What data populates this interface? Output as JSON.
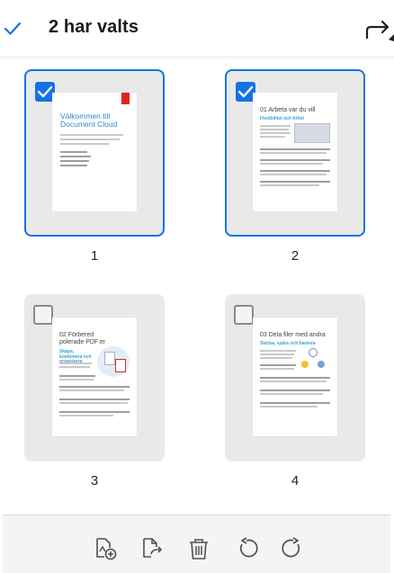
{
  "header": {
    "title": "2 har valts"
  },
  "pages": [
    {
      "number": "1",
      "selected": true,
      "title": "Välkommen till Document Cloud"
    },
    {
      "number": "2",
      "selected": true,
      "title": "01 Arbeta var du vill",
      "subtitle": "Flexibilitet och frihet"
    },
    {
      "number": "3",
      "selected": false,
      "title": "02 Förbered polerade PDF:er",
      "subtitle": "Skapa, kombinera och organisera"
    },
    {
      "number": "4",
      "selected": false,
      "title": "03 Dela filer med andra",
      "subtitle": "Skicka, spåra och hantera"
    }
  ],
  "colors": {
    "accent": "#1473e6",
    "card_bg": "#e9e9e9",
    "adobe_red": "#e1251b",
    "heading_blue": "#2a8ad4"
  },
  "toolbar": {
    "icons": [
      "insert-page-icon",
      "extract-page-icon",
      "delete-icon",
      "rotate-left-icon",
      "rotate-right-icon"
    ]
  }
}
